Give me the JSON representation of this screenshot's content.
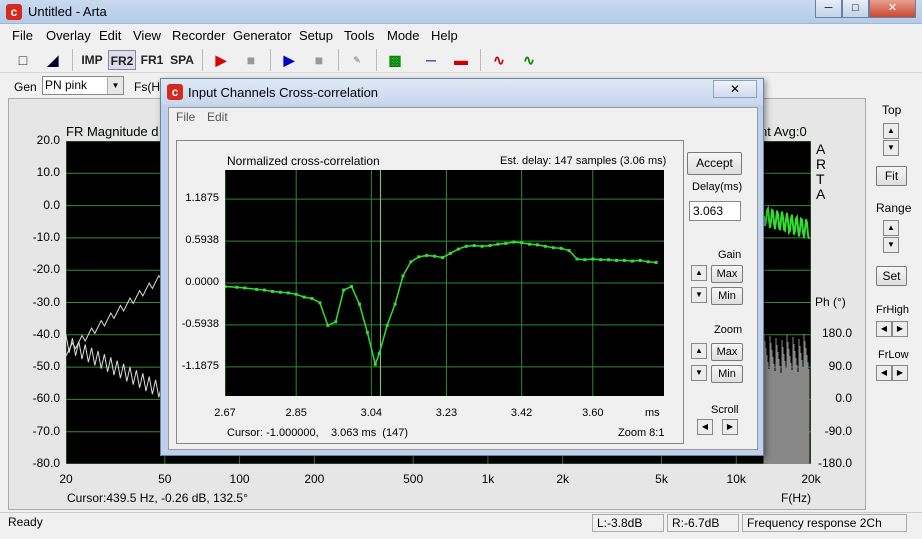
{
  "app": {
    "title": "Untitled - Arta",
    "icon": "arta-logo-icon"
  },
  "window_buttons": [
    "─",
    "□",
    "✕"
  ],
  "menu": [
    "File",
    "Overlay",
    "Edit",
    "View",
    "Recorder",
    "Generator",
    "Setup",
    "Tools",
    "Mode",
    "Help"
  ],
  "toolbar": {
    "imp": "IMP",
    "fr2": "FR2",
    "fr1": "FR1",
    "spa": "SPA"
  },
  "gen": {
    "label": "Gen",
    "value": "PN pink",
    "fs_label": "Fs(Hz"
  },
  "main_plot": {
    "title": "FR Magnitude d",
    "title_right": "ht  Avg:0",
    "arta_label": "A\nR\nT\nA",
    "y_ticks": [
      "20.0",
      "10.0",
      "0.0",
      "-10.0",
      "-20.0",
      "-30.0",
      "-40.0",
      "-50.0",
      "-60.0",
      "-70.0",
      "-80.0"
    ],
    "x_ticks": [
      "20",
      "50",
      "100",
      "200",
      "500",
      "1k",
      "2k",
      "5k",
      "10k",
      "20k"
    ],
    "xlabel": "F(Hz)",
    "ph_label": "Ph (°)",
    "ph_ticks": [
      "180.0",
      "90.0",
      "0.0",
      "-90.0",
      "-180.0"
    ],
    "cursor": "Cursor:439.5 Hz, -0.26 dB, 132.5°"
  },
  "right_panel": {
    "top": "Top",
    "fit": "Fit",
    "range": "Range",
    "set": "Set",
    "frhigh": "FrHigh",
    "frlow": "FrLow"
  },
  "status": {
    "ready": "Ready",
    "left": "L:-3.8dB",
    "right": "R:-6.7dB",
    "mode": "Frequency response 2Ch"
  },
  "dialog": {
    "title": "Input Channels Cross-correlation",
    "menu": [
      "File",
      "Edit"
    ],
    "plot_title": "Normalized cross-correlation",
    "est_delay": "Est. delay: 147 samples (3.06 ms)",
    "accept": "Accept",
    "delay_label": "Delay(ms)",
    "delay_value": "3.063",
    "gain_label": "Gain",
    "zoom_label": "Zoom",
    "scroll_label": "Scroll",
    "max": "Max",
    "min": "Min",
    "cursor": "Cursor: -1.000000,    3.063 ms  (147)",
    "zoom_info": "Zoom 8:1",
    "x_unit": "ms"
  },
  "chart_data": {
    "type": "line",
    "title": "Normalized cross-correlation",
    "x_ticks": [
      "2.67",
      "2.85",
      "3.04",
      "3.23",
      "3.42",
      "3.60"
    ],
    "y_ticks": [
      "1.1875",
      "0.5938",
      "0.0000",
      "-0.5938",
      "-1.1875"
    ],
    "xlim": [
      2.67,
      3.78
    ],
    "ylim": [
      -1.6,
      1.6
    ],
    "cursor_x": 3.063,
    "series": [
      {
        "color": "#33dd33",
        "x": [
          2.67,
          2.7,
          2.72,
          2.75,
          2.77,
          2.79,
          2.81,
          2.83,
          2.85,
          2.87,
          2.89,
          2.91,
          2.93,
          2.95,
          2.97,
          2.99,
          3.01,
          3.03,
          3.05,
          3.06,
          3.08,
          3.1,
          3.12,
          3.14,
          3.16,
          3.18,
          3.2,
          3.22,
          3.24,
          3.26,
          3.28,
          3.3,
          3.32,
          3.34,
          3.36,
          3.38,
          3.4,
          3.42,
          3.44,
          3.46,
          3.48,
          3.5,
          3.52,
          3.54,
          3.56,
          3.58,
          3.6,
          3.62,
          3.64,
          3.66,
          3.68,
          3.7,
          3.72,
          3.74,
          3.76
        ],
        "y": [
          -0.05,
          -0.06,
          -0.07,
          -0.09,
          -0.1,
          -0.12,
          -0.13,
          -0.14,
          -0.16,
          -0.2,
          -0.22,
          -0.28,
          -0.6,
          -0.55,
          -0.1,
          -0.05,
          -0.3,
          -0.7,
          -1.15,
          -1.0,
          -0.6,
          -0.3,
          0.1,
          0.3,
          0.37,
          0.39,
          0.38,
          0.36,
          0.42,
          0.48,
          0.52,
          0.53,
          0.52,
          0.53,
          0.55,
          0.56,
          0.58,
          0.57,
          0.55,
          0.54,
          0.52,
          0.5,
          0.49,
          0.46,
          0.34,
          0.33,
          0.34,
          0.33,
          0.33,
          0.32,
          0.32,
          0.31,
          0.32,
          0.3,
          0.29
        ]
      }
    ]
  }
}
